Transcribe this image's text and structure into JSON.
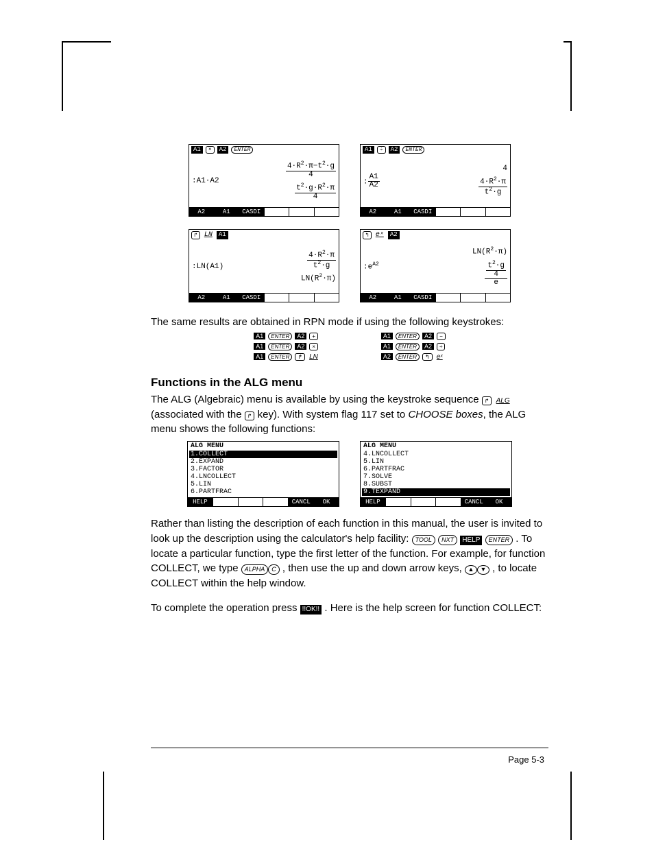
{
  "shots": {
    "s1": {
      "head": [
        {
          "t": "sk",
          "v": "A1"
        },
        {
          "t": "kkey-sq",
          "v": "×"
        },
        {
          "t": "sk",
          "v": "A2"
        },
        {
          "t": "kkey",
          "v": "ENTER"
        }
      ],
      "left": ":A1·A2",
      "r1_html": "<span class='frac'><span class='n'>4·R<sup>2</sup>·π−t<sup>2</sup>·g</span><span class='d'>4</span></span>",
      "r2_html": "<span class='frac'><span class='n'>t<sup>2</sup>·g·R<sup>2</sup>·π</span><span class='d'>4</span></span>",
      "foot": [
        "A2",
        "A1",
        "CASDI",
        "",
        "",
        ""
      ]
    },
    "s2": {
      "head": [
        {
          "t": "sk",
          "v": "A1"
        },
        {
          "t": "kkey-sq",
          "v": "÷"
        },
        {
          "t": "sk",
          "v": "A2"
        },
        {
          "t": "kkey",
          "v": "ENTER"
        }
      ],
      "left_html": ":<span class='frac'><span class='n'>A1</span><span class='d'>A2</span></span>",
      "r1": "4",
      "r2_html": "<span class='frac'><span class='n'>4·R<sup>2</sup>·π</span><span class='d'>t<sup>2</sup>·g</span></span>",
      "foot": [
        "A2",
        "A1",
        "CASDI",
        "",
        "",
        ""
      ]
    },
    "s3": {
      "head": [
        {
          "t": "kkey-sq",
          "v": "↱"
        },
        {
          "t": "ul",
          "v": "LN"
        },
        {
          "t": "sk",
          "v": "A1"
        }
      ],
      "left": ":LN(A1)",
      "r1_html": "<span class='frac'><span class='n'>4·R<sup>2</sup>·π</span><span class='d'>t<sup>2</sup>·g</span></span>",
      "r2_html": "LN(R<sup>2</sup>·π)",
      "foot": [
        "A2",
        "A1",
        "CASDI",
        "",
        "",
        ""
      ]
    },
    "s4": {
      "head": [
        {
          "t": "kkey-sq",
          "v": "↰"
        },
        {
          "t": "ul",
          "v": "eˣ"
        },
        {
          "t": "sk",
          "v": "A2"
        }
      ],
      "left_html": ":e<sup>A2</sup>",
      "r1_html": "LN(R<sup>2</sup>·π)",
      "r2_html": "<span class='frac'><span class='n'><span class='frac'><span class='n'>t<sup>2</sup>·g</span><span class='d'>4</span></span></span><span class='d'>e</span></span>",
      "foot": [
        "A2",
        "A1",
        "CASDI",
        "",
        "",
        ""
      ]
    }
  },
  "p1": "The same results are obtained in RPN mode if using the following keystrokes:",
  "rpn": {
    "left": [
      [
        {
          "t": "sk",
          "v": "A1"
        },
        {
          "t": "kkey",
          "v": "ENTER"
        },
        {
          "t": "sk",
          "v": "A2"
        },
        {
          "t": "kkey-sq",
          "v": "+"
        }
      ],
      [
        {
          "t": "sk",
          "v": "A1"
        },
        {
          "t": "kkey",
          "v": "ENTER"
        },
        {
          "t": "sk",
          "v": "A2"
        },
        {
          "t": "kkey-sq",
          "v": "×"
        }
      ],
      [
        {
          "t": "sk",
          "v": "A1"
        },
        {
          "t": "kkey",
          "v": "ENTER"
        },
        {
          "t": "kkey-sq",
          "v": "↱"
        },
        {
          "t": "ul",
          "v": "LN"
        }
      ]
    ],
    "right": [
      [
        {
          "t": "sk",
          "v": "A1"
        },
        {
          "t": "kkey",
          "v": "ENTER"
        },
        {
          "t": "sk",
          "v": "A2"
        },
        {
          "t": "kkey-sq",
          "v": "−"
        }
      ],
      [
        {
          "t": "sk",
          "v": "A1"
        },
        {
          "t": "kkey",
          "v": "ENTER"
        },
        {
          "t": "sk",
          "v": "A2"
        },
        {
          "t": "kkey-sq",
          "v": "÷"
        }
      ],
      [
        {
          "t": "sk",
          "v": "A2"
        },
        {
          "t": "kkey",
          "v": "ENTER"
        },
        {
          "t": "kkey-sq",
          "v": "↰"
        },
        {
          "t": "ul",
          "v": "eˣ"
        }
      ]
    ]
  },
  "h2": "Functions in the ALG menu",
  "p2a": "The ALG (Algebraic) menu is available by using the keystroke sequence ",
  "p2b": " (associated with the ",
  "p2c": " key).   With system flag 117 set to ",
  "p2d": "CHOOSE boxes",
  "p2e": ", the ALG menu shows the following functions:",
  "menus": {
    "m1": {
      "title": "ALG MENU",
      "items": [
        "1.COLLECT",
        "2.EXPAND",
        "3.FACTOR",
        "4.LNCOLLECT",
        "5.LIN",
        "6.PARTFRAC"
      ],
      "sel": 0,
      "foot": [
        "HELP",
        "",
        "",
        "",
        "CANCL",
        "OK"
      ]
    },
    "m2": {
      "title": "ALG MENU",
      "items": [
        "4.LNCOLLECT",
        "5.LIN",
        "6.PARTFRAC",
        "7.SOLVE",
        "8.SUBST",
        "9.TEXPAND"
      ],
      "sel": 5,
      "foot": [
        "HELP",
        "",
        "",
        "",
        "CANCL",
        "OK"
      ]
    }
  },
  "p3a": "Rather than listing the description of each function in this manual, the user is invited to look up the description using the calculator's help facility: ",
  "p3b": " .  To locate a particular function, type the first letter of the function.  For example, for function COLLECT, we type ",
  "p3c": " , then use the up and down arrow keys, ",
  "p3d": " , to locate COLLECT within the help window.",
  "p4a": "To complete the operation press ",
  "p4b": ".  Here is the help screen for function COLLECT:",
  "keys": {
    "tool": "TOOL",
    "nxt": "NXT",
    "help": "HELP",
    "enter": "ENTER",
    "alpha": "ALPHA",
    "c": "C",
    "ok": "!!OK!!",
    "rshift": "↱",
    "alg": "ALG"
  },
  "pagenum": "Page 5-3"
}
